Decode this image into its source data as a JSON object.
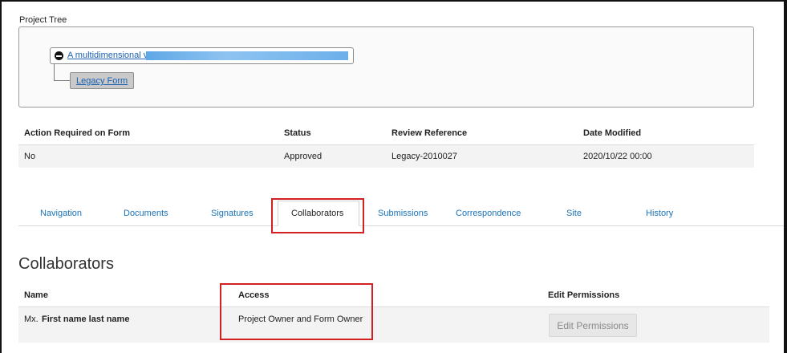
{
  "project_tree": {
    "label": "Project Tree",
    "root_link": "A multidimensional v",
    "child_link": "Legacy Form"
  },
  "summary": {
    "headers": [
      "Action Required on Form",
      "Status",
      "Review Reference",
      "Date Modified"
    ],
    "row": [
      "No",
      "Approved",
      "Legacy-2010027",
      "2020/10/22 00:00"
    ]
  },
  "tabs": [
    {
      "label": "Navigation"
    },
    {
      "label": "Documents"
    },
    {
      "label": "Signatures"
    },
    {
      "label": "Collaborators",
      "active": true
    },
    {
      "label": "Submissions"
    },
    {
      "label": "Correspondence"
    },
    {
      "label": "Site"
    },
    {
      "label": "History"
    }
  ],
  "collaborators": {
    "title": "Collaborators",
    "headers": [
      "Name",
      "Access",
      "Edit Permissions"
    ],
    "rows": [
      {
        "title": "Mx.",
        "name": "First name last name",
        "access": "Project Owner and Form Owner",
        "button": "Edit Permissions"
      }
    ]
  },
  "colors": {
    "link": "#1a73b8",
    "highlight": "#d32020",
    "row_bg": "#f3f3f3"
  }
}
